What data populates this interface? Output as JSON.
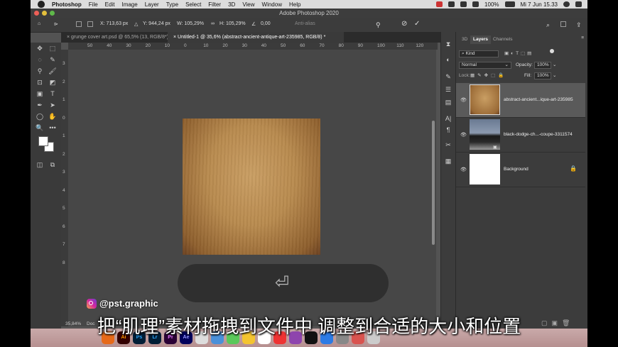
{
  "menubar": {
    "items": [
      "Photoshop",
      "File",
      "Edit",
      "Image",
      "Layer",
      "Type",
      "Select",
      "Filter",
      "3D",
      "View",
      "Window",
      "Help"
    ],
    "battery": "100%",
    "clock": "Mi 7 Jun 15.33"
  },
  "titlebar": {
    "title": "Adobe Photoshop 2020"
  },
  "options": {
    "x": "X: 713,63 px",
    "y": "Y: 944,24 px",
    "w": "W: 105,29%",
    "h": "H: 105,29%",
    "angle": "0,00",
    "antialias": "Anti-alias"
  },
  "tabs": [
    {
      "label": "grunge cover art.psd @ 65,5% (13, RGB/8*)",
      "active": false
    },
    {
      "label": "Untitled-1 @ 35,6% (abstract-ancient-antique-art-235985, RGB/8) *",
      "active": true
    }
  ],
  "ruler": {
    "h": [
      "50",
      "40",
      "30",
      "20",
      "10",
      "0",
      "10",
      "20",
      "30",
      "40",
      "50",
      "60",
      "70",
      "80",
      "90",
      "100",
      "110",
      "120"
    ],
    "v": [
      "3",
      "2",
      "1",
      "0",
      "1",
      "2",
      "3",
      "4",
      "5",
      "6",
      "7",
      "8"
    ]
  },
  "status": {
    "zoom": "35,84%",
    "doc": "Doc"
  },
  "panel": {
    "tabs": [
      "3D",
      "Layers",
      "Channels"
    ],
    "kind": "Kind",
    "blend": "Normal",
    "opacity_label": "Opacity:",
    "opacity": "100%",
    "lock_label": "Lock:",
    "fill_label": "Fill:",
    "fill": "100%",
    "layers": [
      {
        "name": "abstract-ancient...ique-art-235985",
        "thumb": "texture",
        "selected": true
      },
      {
        "name": "black-dodge-ch...-coupe-3311574",
        "thumb": "car",
        "selected": false
      },
      {
        "name": "Background",
        "thumb": "white",
        "selected": false,
        "locked": true
      }
    ]
  },
  "overlay": {
    "instagram": "@pst.graphic",
    "subtitle": "把“肌理”素材拖拽到文件中 调整到合适的大小和位置",
    "enter_key": "⏎"
  },
  "dock": [
    "Ai",
    "Ps",
    "Lr",
    "Pr",
    "Ae"
  ],
  "colors": {
    "accent": "#535353",
    "panel": "#3c3c3c",
    "texture": "#b88a4e"
  }
}
